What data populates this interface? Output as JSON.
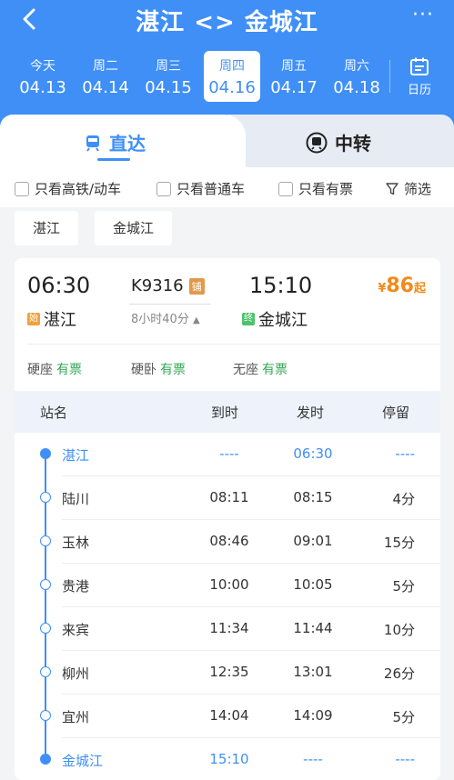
{
  "header": {
    "title": "湛江 <> 金城江",
    "more": "···",
    "calendar_label": "日历",
    "dates": [
      {
        "weekday": "今天",
        "date": "04.13",
        "active": false
      },
      {
        "weekday": "周二",
        "date": "04.14",
        "active": false
      },
      {
        "weekday": "周三",
        "date": "04.15",
        "active": false
      },
      {
        "weekday": "周四",
        "date": "04.16",
        "active": true
      },
      {
        "weekday": "周五",
        "date": "04.17",
        "active": false
      },
      {
        "weekday": "周六",
        "date": "04.18",
        "active": false
      }
    ]
  },
  "tabs": {
    "direct": "直达",
    "transfer": "中转"
  },
  "filters": {
    "high_speed": "只看高铁/动车",
    "regular": "只看普通车",
    "available": "只看有票",
    "filter": "筛选"
  },
  "station_chips": {
    "from": "湛江",
    "to": "金城江"
  },
  "train": {
    "dep_time": "06:30",
    "arr_time": "15:10",
    "number": "K9316",
    "bed_tag": "铺",
    "duration": "8小时40分",
    "dep_tag": "始",
    "arr_tag": "终",
    "dep_station": "湛江",
    "arr_station": "金城江",
    "price_symbol": "¥",
    "price": "86",
    "price_suffix": "起",
    "seats": [
      {
        "type": "硬座",
        "status": "有票"
      },
      {
        "type": "硬卧",
        "status": "有票"
      },
      {
        "type": "无座",
        "status": "有票"
      }
    ]
  },
  "table": {
    "headers": {
      "name": "站名",
      "arrive": "到时",
      "depart": "发时",
      "stay": "停留"
    },
    "rows": [
      {
        "name": "湛江",
        "arrive": "----",
        "depart": "06:30",
        "stay": "----"
      },
      {
        "name": "陆川",
        "arrive": "08:11",
        "depart": "08:15",
        "stay": "4分"
      },
      {
        "name": "玉林",
        "arrive": "08:46",
        "depart": "09:01",
        "stay": "15分"
      },
      {
        "name": "贵港",
        "arrive": "10:00",
        "depart": "10:05",
        "stay": "5分"
      },
      {
        "name": "来宾",
        "arrive": "11:34",
        "depart": "11:44",
        "stay": "10分"
      },
      {
        "name": "柳州",
        "arrive": "12:35",
        "depart": "13:01",
        "stay": "26分"
      },
      {
        "name": "宜州",
        "arrive": "14:04",
        "depart": "14:09",
        "stay": "5分"
      },
      {
        "name": "金城江",
        "arrive": "15:10",
        "depart": "----",
        "stay": "----"
      }
    ]
  },
  "colors": {
    "primary": "#3f8ff6",
    "price": "#f28a1a",
    "available": "#33a854",
    "start_tag": "#f0a23a",
    "end_tag": "#4cc36b"
  }
}
